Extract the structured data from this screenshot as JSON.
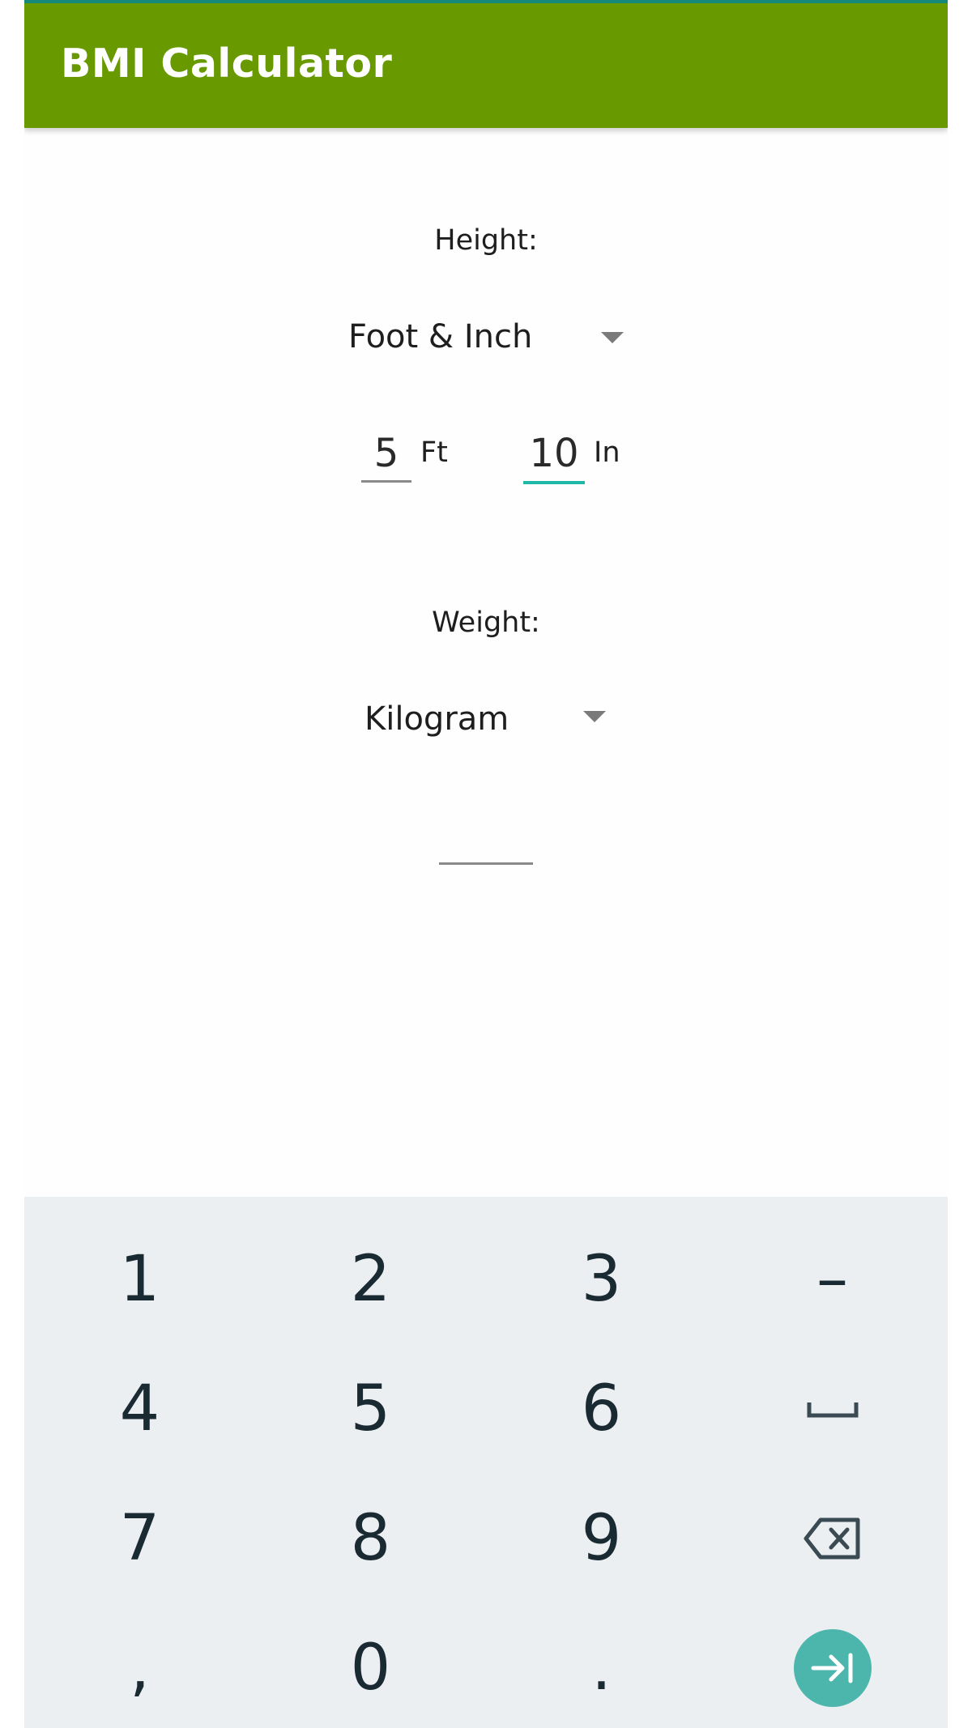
{
  "app": {
    "title": "BMI Calculator",
    "colors": {
      "appbar": "#689a00",
      "accent": "#1fb7a8",
      "enter_key": "#4db6ac"
    }
  },
  "height": {
    "label": "Height:",
    "unit_selected": "Foot & Inch",
    "feet": {
      "value": "5",
      "unit": "Ft"
    },
    "inches": {
      "value": "10",
      "unit": "In"
    }
  },
  "weight": {
    "label": "Weight:",
    "unit_selected": "Kilogram",
    "value": ""
  },
  "keyboard": {
    "row1": [
      "1",
      "2",
      "3",
      "–"
    ],
    "row2": [
      "4",
      "5",
      "6"
    ],
    "row3": [
      "7",
      "8",
      "9"
    ],
    "row4": [
      ",",
      "0",
      "."
    ],
    "icons": {
      "space": "space-icon",
      "backspace": "backspace-icon",
      "next": "next-field-icon"
    }
  }
}
